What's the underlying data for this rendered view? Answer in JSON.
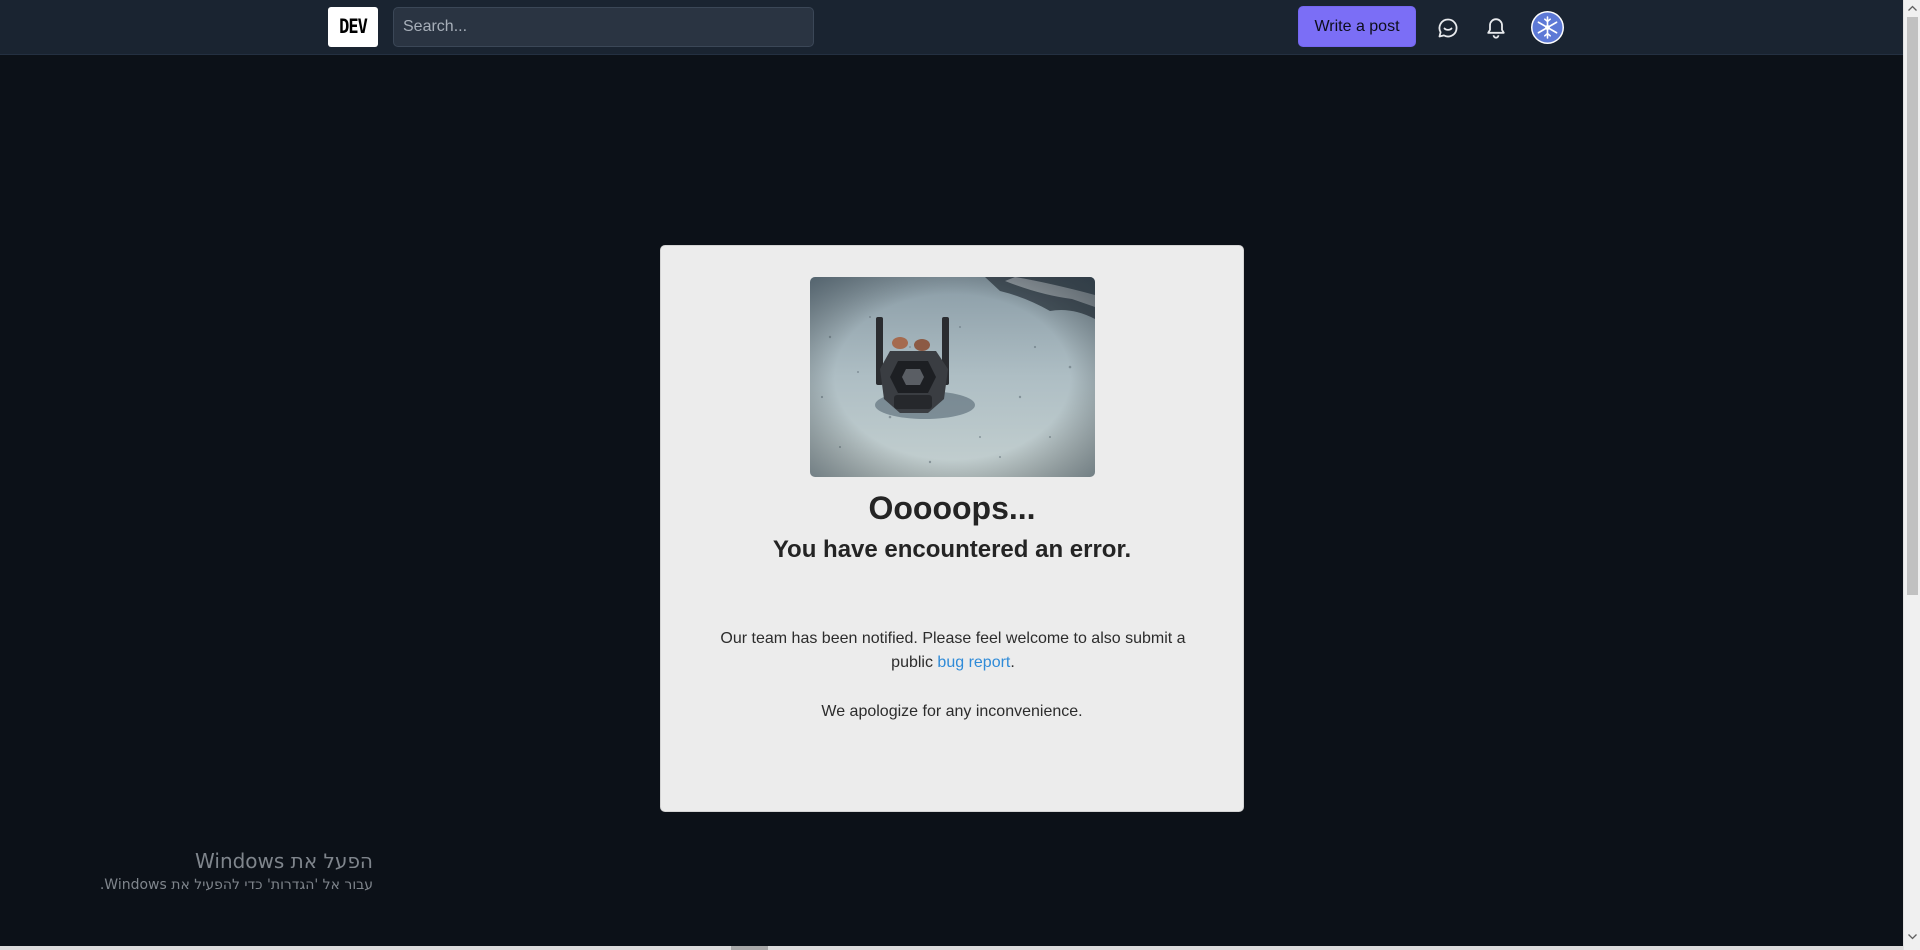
{
  "header": {
    "logo_text": "DEV",
    "search_placeholder": "Search...",
    "write_post_label": "Write a post",
    "icons": [
      "chat-icon",
      "bell-icon",
      "avatar-icon"
    ]
  },
  "error_card": {
    "title": "Ooooops...",
    "subtitle": "You have encountered an error.",
    "message_before_link": "Our team has been notified. Please feel welcome to also submit a public ",
    "link_text": "bug report",
    "message_after_link": ".",
    "apology": "We apologize for any inconvenience."
  },
  "watermark": {
    "title": "הפעל את Windows",
    "subtitle": "עבור אל 'הגדרות' כדי להפעיל את Windows."
  },
  "colors": {
    "background": "#0c1118",
    "header": "#1a2431",
    "accent": "#7b6ef6",
    "card": "#ececec",
    "link": "#2f8bd8"
  }
}
